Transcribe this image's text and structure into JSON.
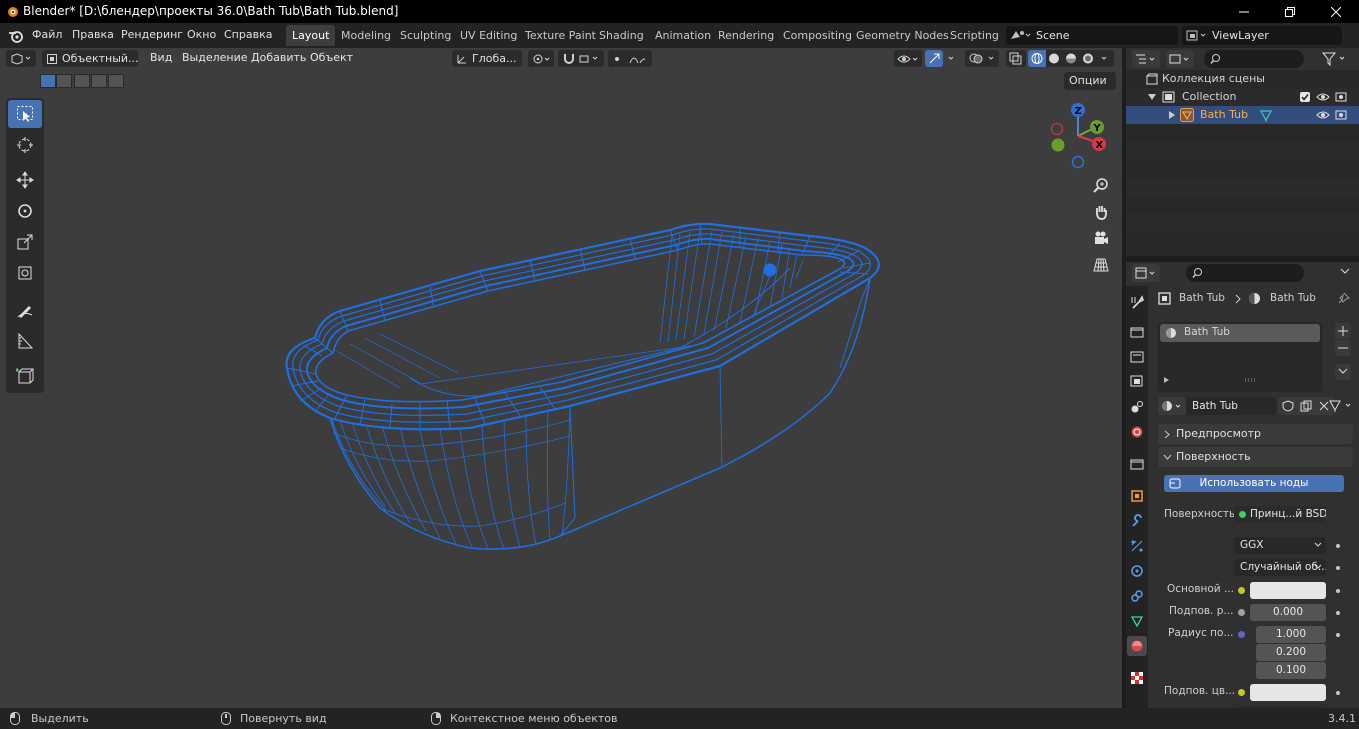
{
  "titlebar": {
    "title": "Blender* [D:\\блендер\\проекты 36.0\\Bath Tub\\Bath Tub.blend]"
  },
  "menus": [
    "Файл",
    "Правка",
    "Рендеринг",
    "Окно",
    "Справка"
  ],
  "workspaces": [
    "Layout",
    "Modeling",
    "Sculpting",
    "UV Editing",
    "Texture Paint",
    "Shading",
    "Animation",
    "Rendering",
    "Compositing",
    "Geometry Nodes",
    "Scripting"
  ],
  "active_workspace": "Layout",
  "scene": "Scene",
  "view_layer": "ViewLayer",
  "viewport": {
    "mode": "Объектный...",
    "menus": [
      "Вид",
      "Выделение",
      "Добавить",
      "Объект"
    ],
    "orientation": "Глоба...",
    "options": "Опции",
    "wire_color": "#1f6fe0"
  },
  "gizmo": {
    "z": "Z",
    "y": "Y",
    "x": "X"
  },
  "outliner": {
    "root": "Коллекция сцены",
    "collection": "Collection",
    "object": "Bath Tub"
  },
  "properties": {
    "breadcrumb_object": "Bath Tub",
    "breadcrumb_material": "Bath Tub",
    "slot": "Bath Tub",
    "material_name": "Bath Tub",
    "panel_preview": "Предпросмотр",
    "panel_surface": "Поверхность",
    "use_nodes": "Использовать ноды",
    "surface_label": "Поверхность",
    "surface_value": "Принц...й BSDF",
    "distribution": "GGX",
    "subsurface_method": "Случайный об...",
    "base_color_label": "Основной ...",
    "subsurface_label": "Подпов. р...",
    "subsurface_value": "0.000",
    "radius_label": "Радиус по...",
    "radius_values": [
      "1.000",
      "0.200",
      "0.100"
    ],
    "subsurface_color_label": "Подпов. цв..."
  },
  "statusbar": {
    "select": "Выделить",
    "rotate": "Повернуть вид",
    "context": "Контекстное меню объектов",
    "version": "3.4.1"
  }
}
